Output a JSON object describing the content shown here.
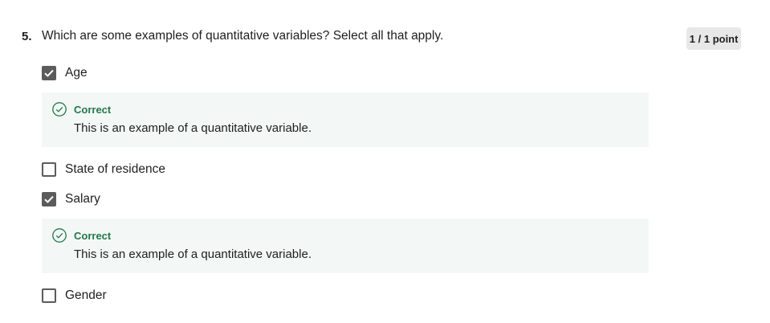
{
  "question": {
    "number": "5.",
    "text": "Which are some examples of quantitative variables? Select all that apply.",
    "points": "1 / 1 point"
  },
  "options": [
    {
      "label": "Age",
      "checked": true,
      "feedback": {
        "title": "Correct",
        "text": "This is an example of a quantitative variable."
      }
    },
    {
      "label": "State of residence",
      "checked": false
    },
    {
      "label": "Salary",
      "checked": true,
      "feedback": {
        "title": "Correct",
        "text": "This is an example of a quantitative variable."
      }
    },
    {
      "label": "Gender",
      "checked": false
    }
  ],
  "colors": {
    "correct": "#1e7a4c",
    "feedback_bg": "#f3f8f6",
    "checkbox": "#5b5b5b"
  },
  "icons": {
    "checkmark": "checkmark-icon",
    "correct": "check-circle-icon"
  }
}
